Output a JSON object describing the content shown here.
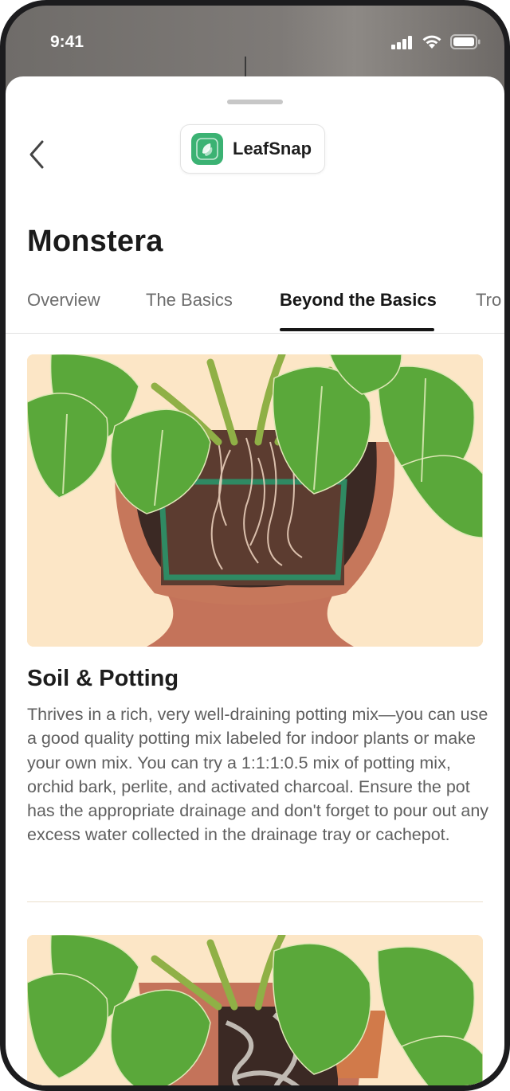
{
  "status_bar": {
    "time": "9:41",
    "icons": [
      "cellular-signal-icon",
      "wifi-icon",
      "battery-icon"
    ]
  },
  "header": {
    "back_icon": "chevron-left-icon",
    "app_name": "LeafSnap",
    "app_logo_icon": "leafsnap-logo-icon"
  },
  "page": {
    "title": "Monstera"
  },
  "tabs": [
    {
      "label": "Overview",
      "active": false
    },
    {
      "label": "The Basics",
      "active": false
    },
    {
      "label": "Beyond the Basics",
      "active": true
    },
    {
      "label": "Tro",
      "active": false
    }
  ],
  "sections": [
    {
      "title": "Soil & Potting",
      "body": "Thrives in a rich, very well-draining potting mix—you can use a good quality potting mix labeled for indoor plants or make your own mix. You can try a 1:1:1:0.5 mix of potting mix, orchid bark, perlite, and activated charcoal. Ensure the pot has the appropriate drainage and don't forget to pour out any excess water collected in the drainage tray or cachepot."
    }
  ],
  "colors": {
    "accent": "#161616",
    "brand_green": "#3bb273",
    "illustration_bg": "#fce6c6",
    "pot_terracotta": "#c0714f",
    "leaf_green": "#5aa83a"
  }
}
